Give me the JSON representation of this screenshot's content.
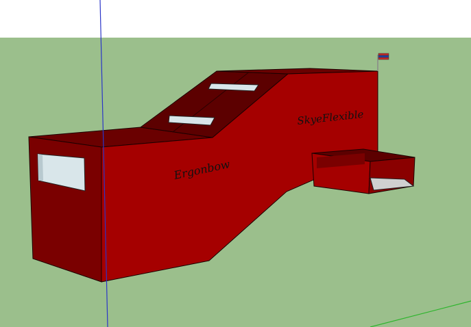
{
  "viewport": {
    "sky_color": "#ffffff",
    "ground_color": "#9bbf8c"
  },
  "model": {
    "front_sign_text": "Ergonbow",
    "tower_sign_text": "SkyeFlexible",
    "body_color": "#a50000",
    "body_dark_color": "#7a0000",
    "roof_color": "#5c0000",
    "window_color": "#d9e6ea"
  },
  "flag": {
    "colors": [
      "#c62828",
      "#1e3ea8",
      "#c62828"
    ]
  },
  "axes": {
    "blue_axis_color": "#2a35c8",
    "green_axis_color": "#2bb52b"
  }
}
